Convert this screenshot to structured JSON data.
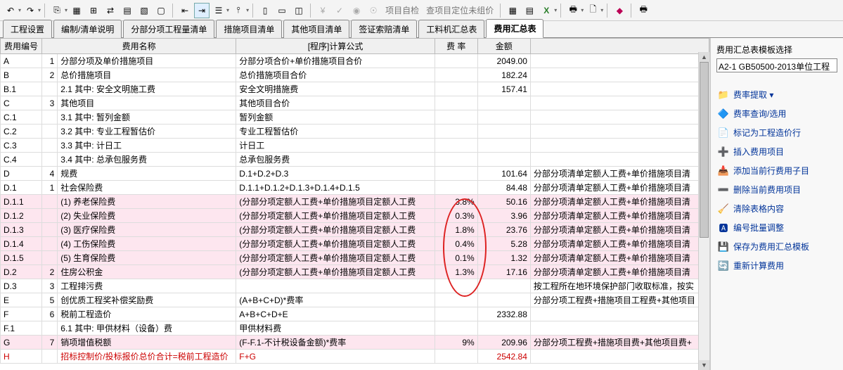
{
  "toolbar": {
    "items": [
      "项",
      "目",
      "自",
      "检",
      "查",
      "项",
      "目",
      "定",
      "位",
      "未",
      "组",
      "价"
    ]
  },
  "tabs": [
    {
      "label": "工程设置"
    },
    {
      "label": "编制/清单说明"
    },
    {
      "label": "分部分项工程量清单"
    },
    {
      "label": "措施项目清单"
    },
    {
      "label": "其他项目清单"
    },
    {
      "label": "签证索赔清单"
    },
    {
      "label": "工料机汇总表"
    },
    {
      "label": "费用汇总表"
    }
  ],
  "headers": {
    "code": "费用编号",
    "name": "费用名称",
    "formula": "[程序]计算公式",
    "rate": "费 率",
    "amount": "金额"
  },
  "rows": [
    {
      "code": "A",
      "idx": "1",
      "name": "分部分项及单价措施项目",
      "formula": "分部分项合价+单价措施项目合价",
      "rate": "",
      "amount": "2049.00",
      "remark": ""
    },
    {
      "code": "B",
      "idx": "2",
      "name": "总价措施项目",
      "formula": "总价措施项目合价",
      "rate": "",
      "amount": "182.24",
      "remark": ""
    },
    {
      "code": "B.1",
      "idx": "",
      "name": "2.1 其中: 安全文明施工费",
      "formula": "安全文明措施费",
      "rate": "",
      "amount": "157.41",
      "remark": ""
    },
    {
      "code": "C",
      "idx": "3",
      "name": "其他项目",
      "formula": "其他项目合价",
      "rate": "",
      "amount": "",
      "remark": ""
    },
    {
      "code": "C.1",
      "idx": "",
      "name": "3.1 其中: 暂列金额",
      "formula": "暂列金额",
      "rate": "",
      "amount": "",
      "remark": ""
    },
    {
      "code": "C.2",
      "idx": "",
      "name": "3.2 其中: 专业工程暂估价",
      "formula": "专业工程暂估价",
      "rate": "",
      "amount": "",
      "remark": ""
    },
    {
      "code": "C.3",
      "idx": "",
      "name": "3.3 其中: 计日工",
      "formula": "计日工",
      "rate": "",
      "amount": "",
      "remark": ""
    },
    {
      "code": "C.4",
      "idx": "",
      "name": "3.4 其中: 总承包服务费",
      "formula": "总承包服务费",
      "rate": "",
      "amount": "",
      "remark": ""
    },
    {
      "code": "D",
      "idx": "4",
      "name": "规费",
      "formula": "D.1+D.2+D.3",
      "rate": "",
      "amount": "101.64",
      "remark": "分部分项清单定额人工费+单价措施项目清"
    },
    {
      "code": "D.1",
      "idx": "1",
      "name": "社会保险费",
      "formula": "D.1.1+D.1.2+D.1.3+D.1.4+D.1.5",
      "rate": "",
      "amount": "84.48",
      "remark": "分部分项清单定额人工费+单价措施项目清"
    },
    {
      "code": "D.1.1",
      "idx": "",
      "name": "(1) 养老保险费",
      "formula": "(分部分项定额人工费+单价措施项目定额人工费",
      "rate": "3.8%",
      "amount": "50.16",
      "remark": "分部分项清单定额人工费+单价措施项目清",
      "pink": true
    },
    {
      "code": "D.1.2",
      "idx": "",
      "name": "(2) 失业保险费",
      "formula": "(分部分项定额人工费+单价措施项目定额人工费",
      "rate": "0.3%",
      "amount": "3.96",
      "remark": "分部分项清单定额人工费+单价措施项目清",
      "pink": true
    },
    {
      "code": "D.1.3",
      "idx": "",
      "name": "(3) 医疗保险费",
      "formula": "(分部分项定额人工费+单价措施项目定额人工费",
      "rate": "1.8%",
      "amount": "23.76",
      "remark": "分部分项清单定额人工费+单价措施项目清",
      "pink": true
    },
    {
      "code": "D.1.4",
      "idx": "",
      "name": "(4) 工伤保险费",
      "formula": "(分部分项定额人工费+单价措施项目定额人工费",
      "rate": "0.4%",
      "amount": "5.28",
      "remark": "分部分项清单定额人工费+单价措施项目清",
      "pink": true
    },
    {
      "code": "D.1.5",
      "idx": "",
      "name": "(5) 生育保险费",
      "formula": "(分部分项定额人工费+单价措施项目定额人工费",
      "rate": "0.1%",
      "amount": "1.32",
      "remark": "分部分项清单定额人工费+单价措施项目清",
      "pink": true
    },
    {
      "code": "D.2",
      "idx": "2",
      "name": "住房公积金",
      "formula": "(分部分项定额人工费+单价措施项目定额人工费",
      "rate": "1.3%",
      "amount": "17.16",
      "remark": "分部分项清单定额人工费+单价措施项目清",
      "pink": true
    },
    {
      "code": "D.3",
      "idx": "3",
      "name": "工程排污费",
      "formula": "",
      "rate": "",
      "amount": "",
      "remark": "按工程所在地环境保护部门收取标准，按实"
    },
    {
      "code": "E",
      "idx": "5",
      "name": "创优质工程奖补偿奖励费",
      "formula": "(A+B+C+D)*费率",
      "rate": "",
      "amount": "",
      "remark": "分部分项工程费+措施项目工程费+其他项目"
    },
    {
      "code": "F",
      "idx": "6",
      "name": "税前工程造价",
      "formula": "A+B+C+D+E",
      "rate": "",
      "amount": "2332.88",
      "remark": ""
    },
    {
      "code": "F.1",
      "idx": "",
      "name": "6.1 其中: 甲供材料（设备）费",
      "formula": "甲供材料费",
      "rate": "",
      "amount": "",
      "remark": ""
    },
    {
      "code": "G",
      "idx": "7",
      "name": "销项增值税额",
      "formula": "(F-F.1-不计税设备金额)*费率",
      "rate": "9%",
      "amount": "209.96",
      "remark": "分部分项工程费+措施项目费+其他项目费+",
      "pink": true
    },
    {
      "code": "H",
      "idx": "",
      "name": "招标控制价/投标报价总价合计=税前工程造价",
      "formula": "F+G",
      "rate": "",
      "amount": "2542.84",
      "remark": "",
      "red": true
    }
  ],
  "side": {
    "title": "费用汇总表模板选择",
    "select_value": "A2-1 GB50500-2013单位工程",
    "actions": [
      {
        "icon": "📁",
        "label": "费率提取 ▾"
      },
      {
        "icon": "🔷",
        "label": "费率查询/选用"
      },
      {
        "icon": "📄",
        "label": "标记为工程造价行"
      },
      {
        "icon": "➕",
        "label": "插入费用项目"
      },
      {
        "icon": "📥",
        "label": "添加当前行费用子目"
      },
      {
        "icon": "➖",
        "label": "删除当前费用项目"
      },
      {
        "icon": "🧹",
        "label": "清除表格内容"
      },
      {
        "icon": "🅰",
        "label": "编号批量调整"
      },
      {
        "icon": "💾",
        "label": "保存为费用汇总模板"
      },
      {
        "icon": "🔄",
        "label": "重新计算费用"
      }
    ]
  }
}
